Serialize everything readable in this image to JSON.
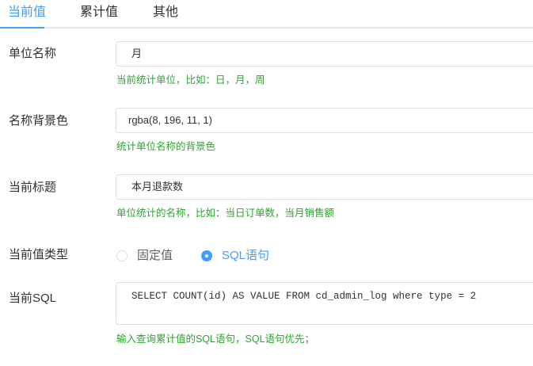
{
  "tabs": [
    {
      "label": "当前值",
      "active": true
    },
    {
      "label": "累计值",
      "active": false
    },
    {
      "label": "其他",
      "active": false
    }
  ],
  "fields": {
    "unit_name": {
      "label": "单位名称",
      "value": "月",
      "hint": "当前统计单位，比如：日，月，周"
    },
    "name_bg_color": {
      "label": "名称背景色",
      "value": "rgba(8, 196, 11, 1)",
      "hint": "统计单位名称的背景色"
    },
    "current_title": {
      "label": "当前标题",
      "value": "本月退款数",
      "hint": "单位统计的名称，比如：当日订单数，当月销售额"
    },
    "value_type": {
      "label": "当前值类型",
      "options": [
        {
          "label": "固定值",
          "checked": false
        },
        {
          "label": "SQL语句",
          "checked": true
        }
      ]
    },
    "current_sql": {
      "label": "当前SQL",
      "value": "SELECT COUNT(id) AS VALUE FROM cd_admin_log where type = 2",
      "hint": "输入查询累计值的SQL语句，SQL语句优先；"
    }
  },
  "colors": {
    "accent": "#409eff",
    "hint": "#2aa52d",
    "border": "#dcdfe6",
    "text": "#303133"
  }
}
